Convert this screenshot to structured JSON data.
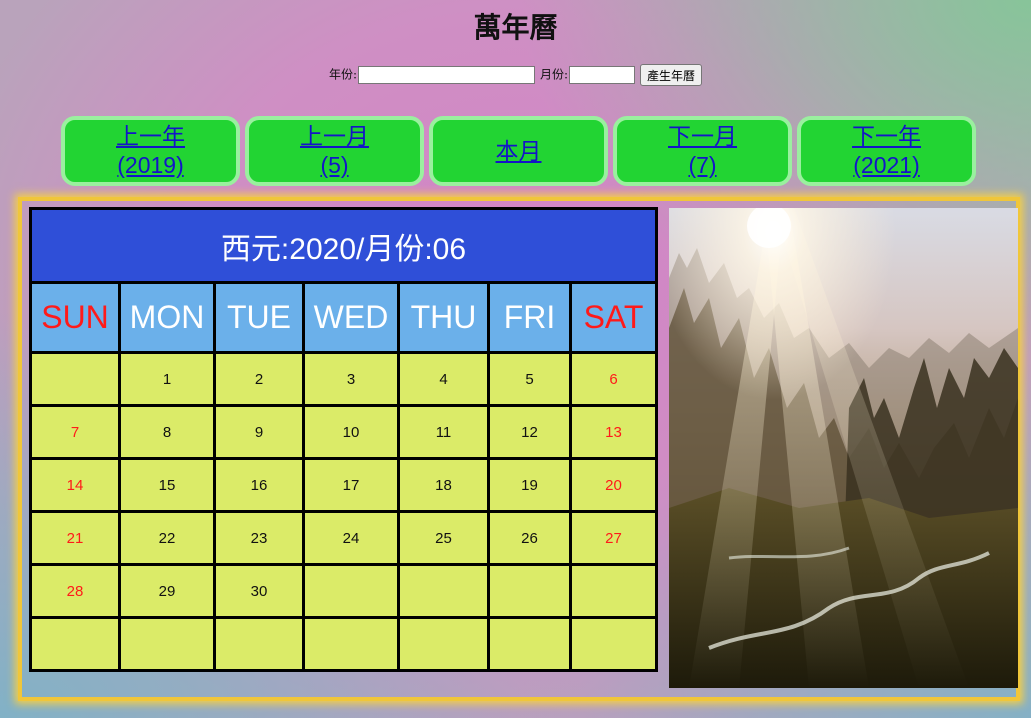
{
  "page": {
    "title": "萬年曆"
  },
  "form": {
    "year_label": "年份:",
    "month_label": "月份:",
    "year_value": "",
    "month_value": "",
    "submit_label": "產生年曆"
  },
  "nav": {
    "prev_year": {
      "label": "上一年",
      "value": "(2019)"
    },
    "prev_month": {
      "label": "上一月",
      "value": "(5)"
    },
    "this_month": {
      "label": "本月"
    },
    "next_month": {
      "label": "下一月",
      "value": "(7)"
    },
    "next_year": {
      "label": "下一年",
      "value": "(2021)"
    }
  },
  "calendar": {
    "header": "西元:2020/月份:06",
    "weekdays": [
      "SUN",
      "MON",
      "TUE",
      "WED",
      "THU",
      "FRI",
      "SAT"
    ],
    "weeks": [
      [
        "",
        "1",
        "2",
        "3",
        "4",
        "5",
        "6"
      ],
      [
        "7",
        "8",
        "9",
        "10",
        "11",
        "12",
        "13"
      ],
      [
        "14",
        "15",
        "16",
        "17",
        "18",
        "19",
        "20"
      ],
      [
        "21",
        "22",
        "23",
        "24",
        "25",
        "26",
        "27"
      ],
      [
        "28",
        "29",
        "30",
        "",
        "",
        "",
        ""
      ],
      [
        "",
        "",
        "",
        "",
        "",
        "",
        ""
      ]
    ]
  },
  "colors": {
    "weekend_text": "#ff1a1a",
    "header_bg": "#2f4fd8",
    "weekday_bg": "#6bb0ea",
    "day_bg": "#dbeb68",
    "nav_button_bg": "#22d433",
    "frame_border": "#f0c63a"
  }
}
